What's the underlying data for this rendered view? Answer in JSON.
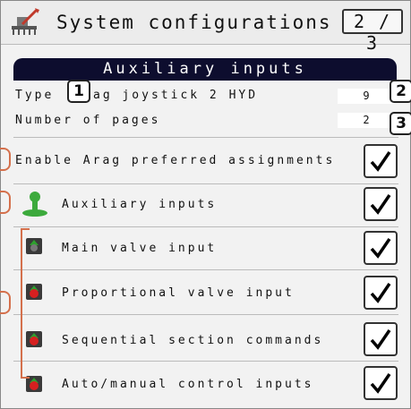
{
  "header": {
    "title": "System configurations",
    "page_indicator": "2/3",
    "icon": "sprayer-settings-icon"
  },
  "section": {
    "title": "Auxiliary inputs"
  },
  "type_row": {
    "label": "Type",
    "value_text": "ag joystick 2  HYD",
    "number": "9"
  },
  "pages_row": {
    "label": "Number of pages",
    "value": "2"
  },
  "rows": [
    {
      "label": "Enable Arag preferred assignments",
      "checked": true,
      "icon": ""
    },
    {
      "label": "Auxiliary inputs",
      "checked": true,
      "icon": "joystick-icon"
    },
    {
      "label": "Main valve input",
      "checked": true,
      "icon": "valve-green-icon"
    },
    {
      "label": "Proportional valve input",
      "checked": true,
      "icon": "valve-red-icon"
    },
    {
      "label": "Sequential section commands",
      "checked": true,
      "icon": "valve-red-icon"
    },
    {
      "label": "Auto/manual control inputs",
      "checked": true,
      "icon": "valve-red-icon"
    }
  ],
  "callouts": [
    "1",
    "2",
    "3"
  ],
  "colors": {
    "accent_bar": "#0d0d2e",
    "callout_bracket": "#d4704c",
    "joystick_green": "#3caa3c",
    "valve_red": "#d62020",
    "valve_green": "#2ea02e"
  }
}
